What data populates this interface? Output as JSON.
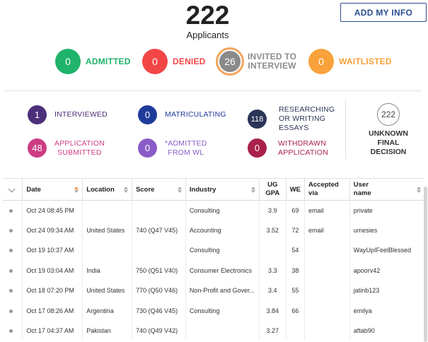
{
  "header": {
    "total": "222",
    "total_label": "Applicants",
    "add_button": "ADD MY INFO"
  },
  "top_stats": [
    {
      "value": "0",
      "label": "ADMITTED",
      "color": "#1fb36b"
    },
    {
      "value": "0",
      "label": "DENIED",
      "color": "#f24646"
    },
    {
      "value": "26",
      "label_line1": "INVITED TO",
      "label_line2": "INTERVIEW",
      "color": "#8a8a8a",
      "ring": "#f4a55c"
    },
    {
      "value": "0",
      "label": "WAITLISTED",
      "color": "#f9a13a"
    }
  ],
  "mid_stats": [
    {
      "value": "1",
      "line1": "INTERVIEWED",
      "line2": "",
      "line3": "",
      "color": "#4b2f7a"
    },
    {
      "value": "0",
      "line1": "MATRICULATING",
      "line2": "",
      "line3": "",
      "color": "#1f3c9c"
    },
    {
      "value": "118",
      "line1": "RESEARCHING",
      "line2": "OR WRITING",
      "line3": "ESSAYS",
      "color": "#2b3557"
    },
    {
      "value": "48",
      "line1": "APPLICATION",
      "line2": "SUBMITTED",
      "line3": "",
      "color": "#cc3d82"
    },
    {
      "value": "0",
      "line1": "*ADMITTED",
      "line2": "FROM WL",
      "line3": "",
      "color": "#8a5cc7"
    },
    {
      "value": "0",
      "line1": "WITHDRAWN",
      "line2": "APPLICATION",
      "line3": "",
      "color": "#a8224b"
    }
  ],
  "unknown": {
    "value": "222",
    "line1": "UNKNOWN",
    "line2": "FINAL",
    "line3": "DECISION"
  },
  "table": {
    "headers": {
      "date": "Date",
      "location": "Location",
      "score": "Score",
      "industry": "Industry",
      "gpa_line1": "UG",
      "gpa_line2": "GPA",
      "we": "WE",
      "accepted_line1": "Accepted",
      "accepted_line2": "via",
      "user_line1": "User",
      "user_line2": "name"
    },
    "rows": [
      {
        "date": "Oct 24 08:45 PM",
        "location": "",
        "score": "",
        "industry": "Consulting",
        "gpa": "3.9",
        "we": "69",
        "via": "email",
        "user": "private"
      },
      {
        "date": "Oct 24 09:34 AM",
        "location": "United States",
        "score": "740 (Q47 V45)",
        "industry": "Accounting",
        "gpa": "3.52",
        "we": "72",
        "via": "email",
        "user": "umesies"
      },
      {
        "date": "Oct 19 10:37 AM",
        "location": "",
        "score": "",
        "industry": "Consulting",
        "gpa": "",
        "we": "54",
        "via": "",
        "user": "WayUpIFeelBlessed"
      },
      {
        "date": "Oct 19 03:04 AM",
        "location": "India",
        "score": "750 (Q51 V40)",
        "industry": "Consumer Electronics",
        "gpa": "3.3",
        "we": "38",
        "via": "",
        "user": "apoorv42"
      },
      {
        "date": "Oct 18 07:20 PM",
        "location": "United States",
        "score": "770 (Q50 V46)",
        "industry": "Non-Profit and Gover...",
        "gpa": "3.4",
        "we": "55",
        "via": "",
        "user": "jatinb123"
      },
      {
        "date": "Oct 17 08:26 AM",
        "location": "Argentina",
        "score": "730 (Q46 V45)",
        "industry": "Consulting",
        "gpa": "3.84",
        "we": "66",
        "via": "",
        "user": "emilya"
      },
      {
        "date": "Oct 17 04:37 AM",
        "location": "Pakistan",
        "score": "740 (Q49 V42)",
        "industry": "",
        "gpa": "3.27",
        "we": "",
        "via": "",
        "user": "aftab90"
      }
    ]
  }
}
